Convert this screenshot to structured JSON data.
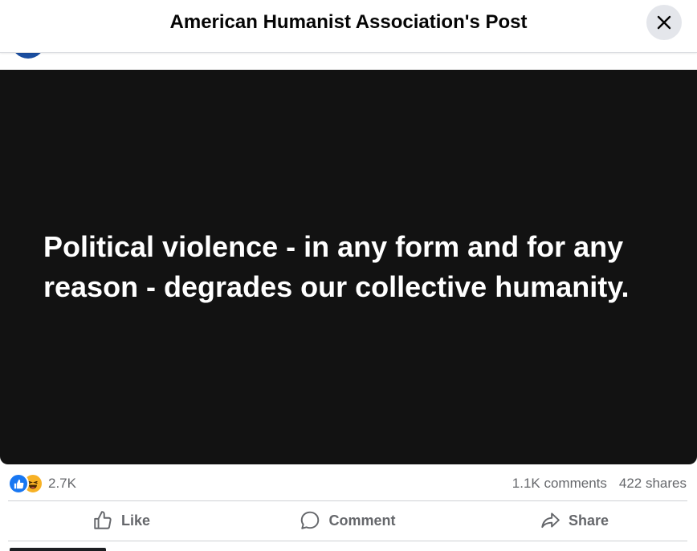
{
  "header": {
    "title": "American Humanist Association's Post",
    "close_icon": "close-icon"
  },
  "post": {
    "image_text": "Political violence - in any form and for any reason - degrades our collective humanity.",
    "image_background": "#121212"
  },
  "engagement": {
    "reaction_icons": [
      "like-reaction-icon",
      "haha-reaction-icon"
    ],
    "reaction_count": "2.7K",
    "comments": "1.1K comments",
    "shares": "422 shares"
  },
  "actions": {
    "like_label": "Like",
    "comment_label": "Comment",
    "share_label": "Share"
  },
  "colors": {
    "accent": "#1877f2",
    "secondary_text": "#65676b"
  }
}
